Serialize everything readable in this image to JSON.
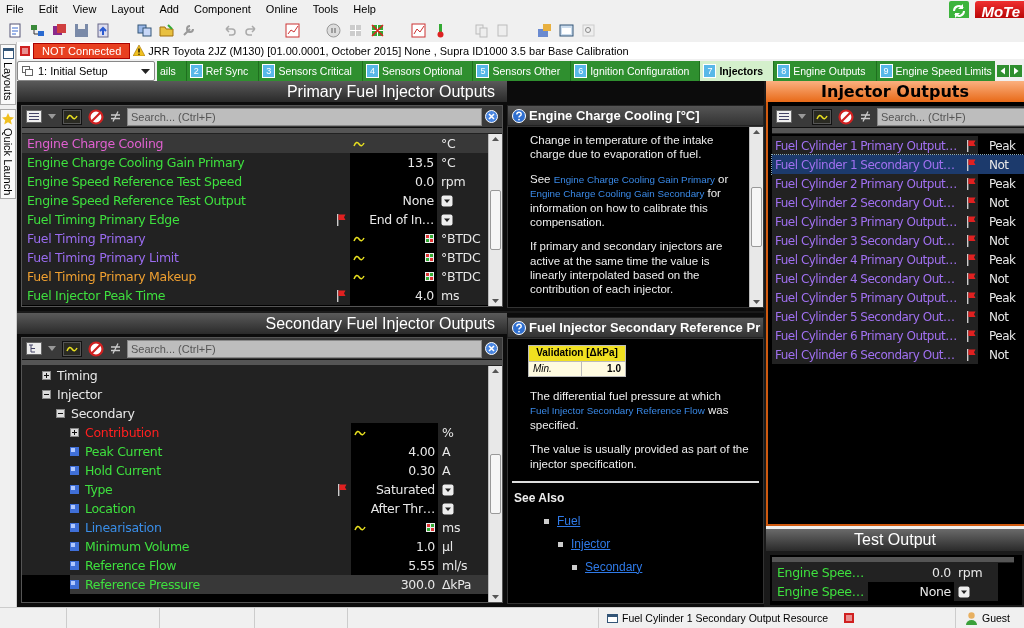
{
  "menu": [
    "File",
    "Edit",
    "View",
    "Layout",
    "Add",
    "Component",
    "Online",
    "Tools",
    "Help"
  ],
  "logo": "MoTe",
  "connection": {
    "status": "NOT Connected",
    "connected": false,
    "project": "JRR Toyota 2JZ (M130) [01.00.0001, October 2015] None , Supra ID1000 3.5 bar Base Calibration"
  },
  "dock_tabs": [
    "Layouts",
    "Quick Launch"
  ],
  "workbook": {
    "selector": "1: Initial Setup",
    "tabs": [
      {
        "label": "ails",
        "selected": false
      },
      {
        "number": "2",
        "label": "Ref Sync",
        "selected": false
      },
      {
        "number": "3",
        "label": "Sensors Critical",
        "selected": false
      },
      {
        "number": "4",
        "label": "Sensors Optional",
        "selected": false
      },
      {
        "number": "5",
        "label": "Sensors Other",
        "selected": false
      },
      {
        "number": "6",
        "label": "Ignition Configuration",
        "selected": false
      },
      {
        "number": "7",
        "label": "Injectors",
        "selected": true
      },
      {
        "number": "8",
        "label": "Engine Outputs",
        "selected": false
      },
      {
        "number": "9",
        "label": "Engine Speed Limits",
        "selected": false
      }
    ]
  },
  "primary": {
    "title": "Primary Fuel Injector Outputs",
    "search_placeholder": "Search... (Ctrl+F)",
    "rows": [
      {
        "name": "Engine Charge Cooling",
        "color": "#e060d0",
        "flagged": false,
        "graph": true,
        "table": false,
        "unit": "°C",
        "dropdown": false,
        "selected": true
      },
      {
        "name": "Engine Charge Cooling Gain Primary",
        "color": "#3ee03e",
        "flagged": false,
        "graph": false,
        "table": false,
        "value": "13.5",
        "unit": "°C",
        "dropdown": false,
        "selected": false
      },
      {
        "name": "Engine Speed Reference Test Speed",
        "color": "#3ee03e",
        "flagged": false,
        "graph": false,
        "table": false,
        "value": "0.0",
        "unit": "rpm",
        "dropdown": false,
        "selected": false
      },
      {
        "name": "Engine Speed Reference Test Output",
        "color": "#3ee03e",
        "flagged": false,
        "graph": false,
        "table": false,
        "value": "None",
        "dropdown": true,
        "selected": false
      },
      {
        "name": "Fuel Timing Primary Edge",
        "color": "#3ee03e",
        "flagged": true,
        "graph": false,
        "table": false,
        "value": "End of In…",
        "dropdown": true,
        "selected": false
      },
      {
        "name": "Fuel Timing Primary",
        "color": "#9a6cf0",
        "flagged": false,
        "graph": true,
        "table": true,
        "unit": "°BTDC",
        "dropdown": false,
        "selected": false
      },
      {
        "name": "Fuel Timing Primary Limit",
        "color": "#9a6cf0",
        "flagged": false,
        "graph": true,
        "table": true,
        "unit": "°BTDC",
        "dropdown": false,
        "selected": false
      },
      {
        "name": "Fuel Timing Primary Makeup",
        "color": "#f0a030",
        "flagged": false,
        "graph": true,
        "table": true,
        "unit": "°BTDC",
        "dropdown": false,
        "selected": false
      },
      {
        "name": "Fuel Injector Peak Time",
        "color": "#3ee03e",
        "flagged": true,
        "graph": false,
        "table": false,
        "value": "4.0",
        "unit": "ms",
        "dropdown": false,
        "selected": false
      }
    ]
  },
  "help_primary": {
    "title": "Engine Charge Cooling [°C]",
    "paragraphs": [
      [
        {
          "text": "Change in temperature of the intake charge due to evaporation of fuel.",
          "link": false
        }
      ],
      [
        {
          "text": "See ",
          "link": false
        },
        {
          "text": "Engine Charge Cooling Gain Primary",
          "link": true
        },
        {
          "text": " or ",
          "link": false
        },
        {
          "text": "Engine Charge Cooling Gain Secondary",
          "link": true
        },
        {
          "text": " for information on how to calibrate this compensation.",
          "link": false
        }
      ],
      [
        {
          "text": "If primary and secondary injectors are active at the same time the value is linearly interpolated based on the contribution of each injector.",
          "link": false
        }
      ]
    ]
  },
  "secondary": {
    "title": "Secondary Fuel Injector Outputs",
    "search_placeholder": "Search... (Ctrl+F)",
    "tree": [
      {
        "name": "Timing",
        "kind": "group",
        "expanded": false,
        "selected": false
      },
      {
        "name": "Injector",
        "kind": "group",
        "expanded": true,
        "selected": false,
        "children": [
          {
            "name": "Secondary",
            "kind": "group",
            "expanded": true,
            "selected": false,
            "children": [
              {
                "name": "Contribution",
                "kind": "group",
                "expanded": false,
                "color": "#ff2020",
                "graph": true,
                "unit": "%",
                "selected": false
              },
              {
                "name": "Peak Current",
                "kind": "item",
                "color": "#3ee03e",
                "value": "4.00",
                "unit": "A",
                "selected": false
              },
              {
                "name": "Hold Current",
                "kind": "item",
                "color": "#3ee03e",
                "value": "0.30",
                "unit": "A",
                "selected": false
              },
              {
                "name": "Type",
                "kind": "item",
                "color": "#3ee03e",
                "flagged": true,
                "value": "Saturated",
                "dropdown": true,
                "selected": false
              },
              {
                "name": "Location",
                "kind": "item",
                "color": "#3ee03e",
                "value": "After Thr…",
                "dropdown": true,
                "selected": false
              },
              {
                "name": "Linearisation",
                "kind": "item",
                "color": "#3a8ee8",
                "graph": true,
                "table": true,
                "unit": "ms",
                "selected": false
              },
              {
                "name": "Minimum Volume",
                "kind": "item",
                "color": "#3ee03e",
                "value": "1.0",
                "unit": "µl",
                "selected": false
              },
              {
                "name": "Reference Flow",
                "kind": "item",
                "color": "#3ee03e",
                "value": "5.55",
                "unit": "ml/s",
                "selected": false
              },
              {
                "name": "Reference Pressure",
                "kind": "item",
                "color": "#3ee03e",
                "value": "300.0",
                "unit": "ΔkPa",
                "selected": true
              }
            ]
          }
        ]
      }
    ]
  },
  "help_secondary": {
    "title": "Fuel Injector Secondary Reference Pr",
    "validation": {
      "header": "Validation [ΔkPa]",
      "rows": [
        {
          "label": "Min.",
          "value": "1.0"
        }
      ]
    },
    "paragraphs": [
      [
        {
          "text": "The differential fuel pressure at which ",
          "link": false
        },
        {
          "text": "Fuel Injector Secondary Reference Flow",
          "link": true
        },
        {
          "text": " was specified.",
          "link": false
        }
      ],
      [
        {
          "text": "The value is usually provided as part of the injector specification.",
          "link": false
        }
      ]
    ],
    "see_also": {
      "title": "See Also",
      "links": [
        {
          "text": "Fuel",
          "children": [
            {
              "text": "Injector",
              "children": [
                {
                  "text": "Secondary"
                }
              ]
            }
          ]
        }
      ]
    }
  },
  "outputs": {
    "title": "Injector Outputs",
    "search_placeholder": "Search... (Ctrl+F)",
    "rows": [
      {
        "name": "Fuel Cylinder 1 Primary Output…",
        "flagged": true,
        "value": "Peak",
        "selected": false
      },
      {
        "name": "Fuel Cylinder 1 Secondary Out…",
        "flagged": true,
        "value": "Not",
        "selected": true
      },
      {
        "name": "Fuel Cylinder 2 Primary Output…",
        "flagged": true,
        "value": "Peak",
        "selected": false
      },
      {
        "name": "Fuel Cylinder 2 Secondary Out…",
        "flagged": true,
        "value": "Not",
        "selected": false
      },
      {
        "name": "Fuel Cylinder 3 Primary Output…",
        "flagged": true,
        "value": "Peak",
        "selected": false
      },
      {
        "name": "Fuel Cylinder 3 Secondary Out…",
        "flagged": true,
        "value": "Not",
        "selected": false
      },
      {
        "name": "Fuel Cylinder 4 Primary Output…",
        "flagged": true,
        "value": "Peak",
        "selected": false
      },
      {
        "name": "Fuel Cylinder 4 Secondary Out…",
        "flagged": true,
        "value": "Not",
        "selected": false
      },
      {
        "name": "Fuel Cylinder 5 Primary Output…",
        "flagged": true,
        "value": "Peak",
        "selected": false
      },
      {
        "name": "Fuel Cylinder 5 Secondary Out…",
        "flagged": true,
        "value": "Not",
        "selected": false
      },
      {
        "name": "Fuel Cylinder 6 Primary Output…",
        "flagged": true,
        "value": "Peak",
        "selected": false
      },
      {
        "name": "Fuel Cylinder 6 Secondary Out…",
        "flagged": true,
        "value": "Not",
        "selected": false
      }
    ]
  },
  "test": {
    "title": "Test Output",
    "rows": [
      {
        "name": "Engine Spee…",
        "value": "0.0",
        "unit": "rpm",
        "dropdown": false
      },
      {
        "name": "Engine Spee…",
        "value": "None",
        "dropdown": true
      }
    ]
  },
  "status_bar": {
    "message": "Fuel Cylinder 1 Secondary Output Resource",
    "user": "Guest"
  }
}
